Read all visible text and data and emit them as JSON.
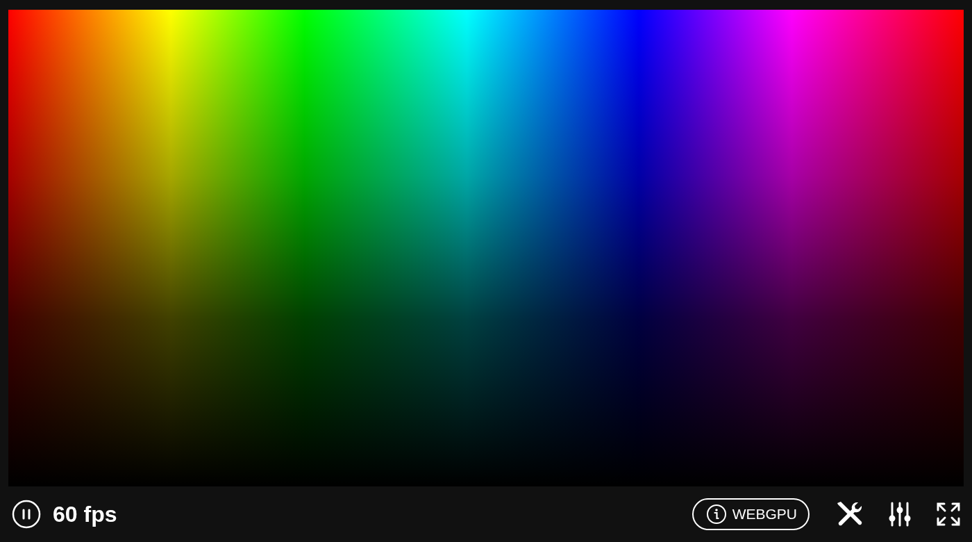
{
  "player": {
    "paused": false,
    "fps": "60 fps"
  },
  "api_badge": {
    "label": "WEBGPU"
  }
}
